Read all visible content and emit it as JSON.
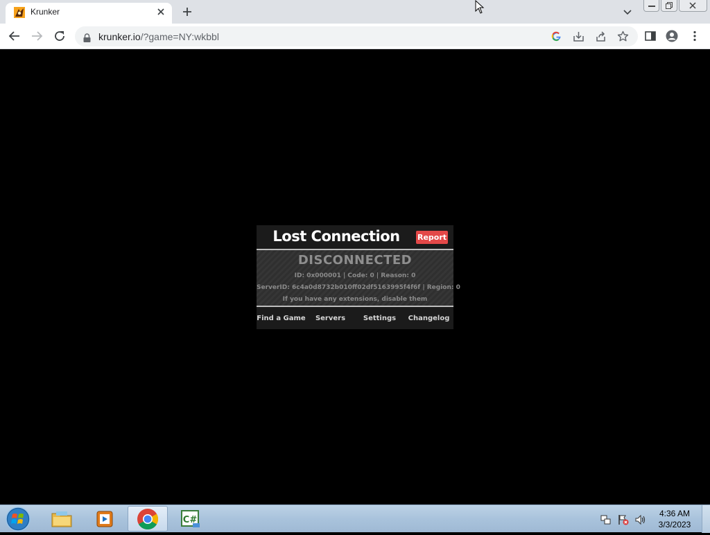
{
  "browser": {
    "tab": {
      "title": "Krunker"
    },
    "url": {
      "host": "krunker.io",
      "path": "/?game=NY:wkbbl"
    }
  },
  "dialog": {
    "title": "Lost Connection",
    "report_label": "Report",
    "status": "DISCONNECTED",
    "info_line": "ID: 0x000001 | Code: 0 | Reason: 0",
    "server_line": "ServerID: 6c4a0d8732b010ff02df5163995f4f6f | Region: 0",
    "hint_line": "If you have any extensions, disable them",
    "nav": [
      "Find a Game",
      "Servers",
      "Settings",
      "Changelog"
    ]
  },
  "taskbar": {
    "time": "4:36 AM",
    "date": "3/3/2023"
  },
  "colors": {
    "report_button": "#e34848",
    "dialog_bg": "#1b1b1b",
    "page_bg": "#000000"
  }
}
